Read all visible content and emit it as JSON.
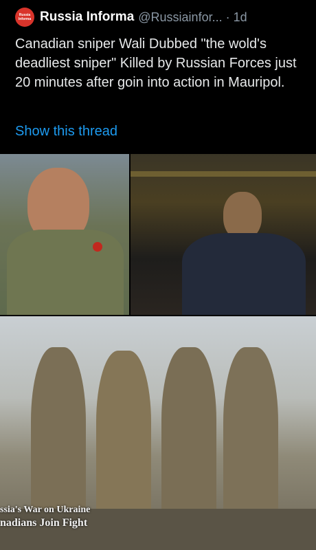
{
  "tweet": {
    "author": {
      "display_name": "Russia Informa",
      "handle": "@Russiainfor...",
      "separator": "·",
      "time": "1d",
      "avatar_text_1": "Russia",
      "avatar_text_2": "Informa"
    },
    "text": "Canadian sniper Wali Dubbed \"the wold's deadliest sniper\" Killed by Russian Forces just 20 minutes after goin into action in Mauripol.",
    "show_thread_label": "Show this thread"
  },
  "media": {
    "photo_3_caption_line_1": "ssia's War on Ukraine",
    "photo_3_caption_line_2": "nadians Join Fight"
  },
  "colors": {
    "background": "#000000",
    "link": "#1d9bf0",
    "muted": "#8b98a5",
    "avatar_brand": "#d9342b"
  }
}
